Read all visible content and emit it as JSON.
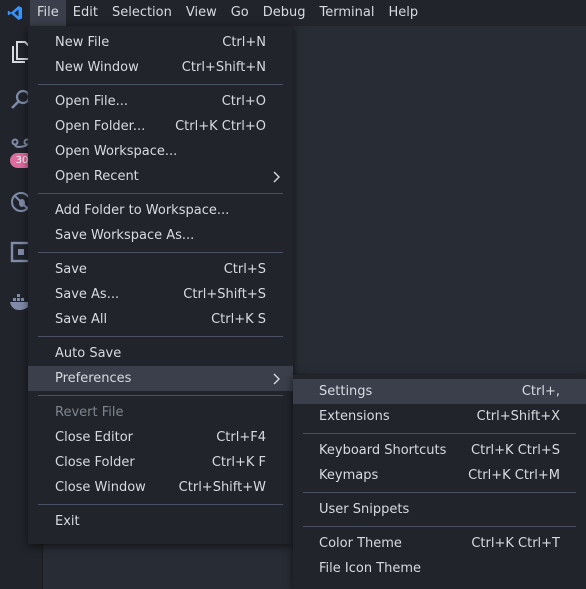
{
  "menubar": {
    "items": [
      "File",
      "Edit",
      "Selection",
      "View",
      "Go",
      "Debug",
      "Terminal",
      "Help"
    ]
  },
  "activity": {
    "badge": "30"
  },
  "file_menu": {
    "new_file": {
      "label": "New File",
      "shortcut": "Ctrl+N"
    },
    "new_window": {
      "label": "New Window",
      "shortcut": "Ctrl+Shift+N"
    },
    "open_file": {
      "label": "Open File...",
      "shortcut": "Ctrl+O"
    },
    "open_folder": {
      "label": "Open Folder...",
      "shortcut": "Ctrl+K Ctrl+O"
    },
    "open_workspace": {
      "label": "Open Workspace...",
      "shortcut": ""
    },
    "open_recent": {
      "label": "Open Recent",
      "shortcut": ""
    },
    "add_folder": {
      "label": "Add Folder to Workspace...",
      "shortcut": ""
    },
    "save_workspace_as": {
      "label": "Save Workspace As...",
      "shortcut": ""
    },
    "save": {
      "label": "Save",
      "shortcut": "Ctrl+S"
    },
    "save_as": {
      "label": "Save As...",
      "shortcut": "Ctrl+Shift+S"
    },
    "save_all": {
      "label": "Save All",
      "shortcut": "Ctrl+K S"
    },
    "auto_save": {
      "label": "Auto Save",
      "shortcut": ""
    },
    "preferences": {
      "label": "Preferences",
      "shortcut": ""
    },
    "revert_file": {
      "label": "Revert File",
      "shortcut": ""
    },
    "close_editor": {
      "label": "Close Editor",
      "shortcut": "Ctrl+F4"
    },
    "close_folder": {
      "label": "Close Folder",
      "shortcut": "Ctrl+K F"
    },
    "close_window": {
      "label": "Close Window",
      "shortcut": "Ctrl+Shift+W"
    },
    "exit": {
      "label": "Exit",
      "shortcut": ""
    }
  },
  "prefs_menu": {
    "settings": {
      "label": "Settings",
      "shortcut": "Ctrl+,"
    },
    "extensions": {
      "label": "Extensions",
      "shortcut": "Ctrl+Shift+X"
    },
    "keyboard_shortcuts": {
      "label": "Keyboard Shortcuts",
      "shortcut": "Ctrl+K Ctrl+S"
    },
    "keymaps": {
      "label": "Keymaps",
      "shortcut": "Ctrl+K Ctrl+M"
    },
    "user_snippets": {
      "label": "User Snippets",
      "shortcut": ""
    },
    "color_theme": {
      "label": "Color Theme",
      "shortcut": "Ctrl+K Ctrl+T"
    },
    "file_icon_theme": {
      "label": "File Icon Theme",
      "shortcut": ""
    }
  },
  "colors": {
    "accent": "#3794ff",
    "menu_bg": "#21252b",
    "highlight": "#3a3f4b",
    "badge": "#e06c9f"
  }
}
